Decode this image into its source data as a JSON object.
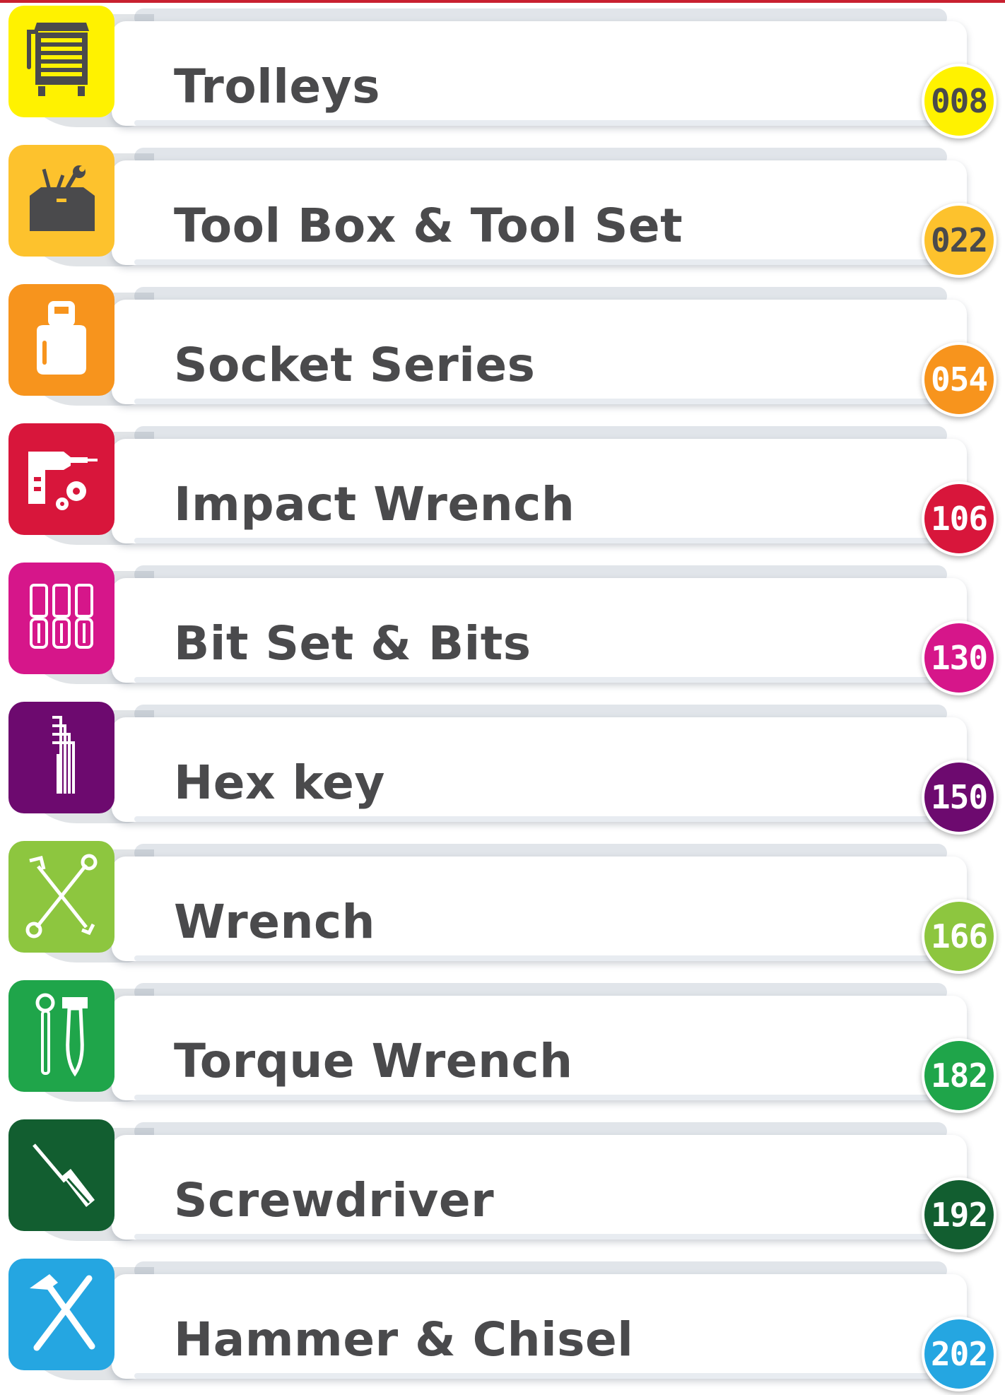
{
  "entries": [
    {
      "label": "Trolleys",
      "page": "008",
      "color": "#fff200",
      "text_color": "#ffffff",
      "num_color": "#4a4a4c",
      "icon": "trolley-icon"
    },
    {
      "label": "Tool Box & Tool Set",
      "page": "022",
      "color": "#fdc22d",
      "num_color": "#4a4a4c",
      "icon": "toolbox-icon"
    },
    {
      "label": "Socket Series",
      "page": "054",
      "color": "#f7941d",
      "num_color": "#ffffff",
      "icon": "socket-icon"
    },
    {
      "label": "Impact Wrench",
      "page": "106",
      "color": "#d8163b",
      "num_color": "#ffffff",
      "icon": "impact-wrench-icon"
    },
    {
      "label": "Bit Set & Bits",
      "page": "130",
      "color": "#d6168a",
      "num_color": "#ffffff",
      "icon": "bit-set-icon"
    },
    {
      "label": "Hex key",
      "page": "150",
      "color": "#6d0a6f",
      "num_color": "#ffffff",
      "icon": "hex-key-icon"
    },
    {
      "label": "Wrench",
      "page": "166",
      "color": "#8dc63f",
      "num_color": "#ffffff",
      "icon": "wrench-icon"
    },
    {
      "label": "Torque Wrench",
      "page": "182",
      "color": "#1fa54a",
      "num_color": "#ffffff",
      "icon": "torque-wrench-icon"
    },
    {
      "label": "Screwdriver",
      "page": "192",
      "color": "#125e30",
      "num_color": "#ffffff",
      "icon": "screwdriver-icon"
    },
    {
      "label": "Hammer & Chisel",
      "page": "202",
      "color": "#25a6e1",
      "num_color": "#ffffff",
      "icon": "hammer-chisel-icon"
    }
  ]
}
